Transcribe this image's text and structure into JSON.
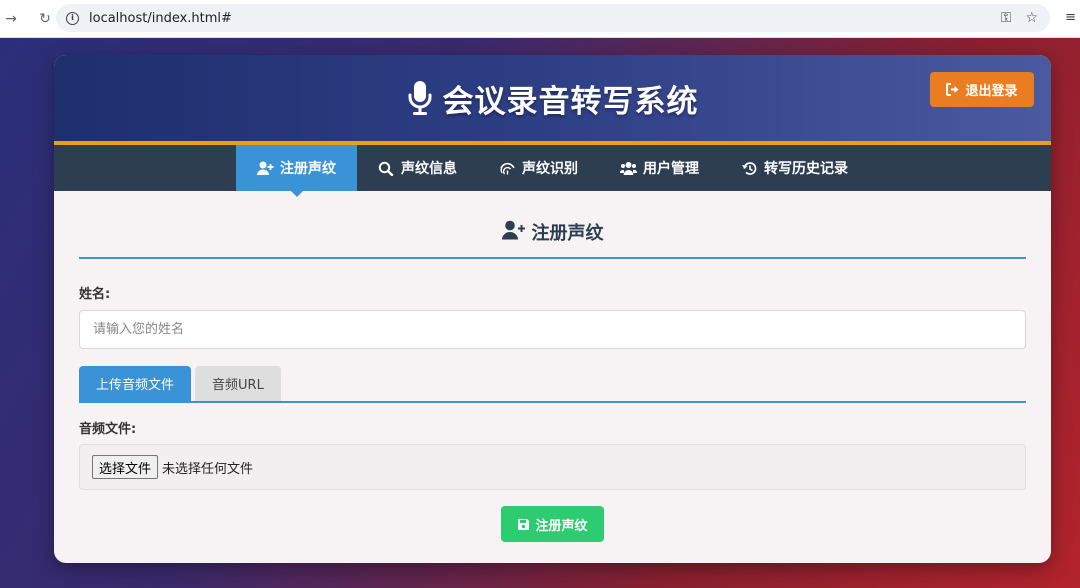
{
  "browser": {
    "url": "localhost/index.html#"
  },
  "header": {
    "title": "会议录音转写系统",
    "logout_label": "退出登录"
  },
  "nav": {
    "items": [
      {
        "label": "注册声纹",
        "icon": "user-plus-icon",
        "active": true
      },
      {
        "label": "声纹信息",
        "icon": "search-icon",
        "active": false
      },
      {
        "label": "声纹识别",
        "icon": "fingerprint-icon",
        "active": false
      },
      {
        "label": "用户管理",
        "icon": "users-icon",
        "active": false
      },
      {
        "label": "转写历史记录",
        "icon": "history-icon",
        "active": false
      }
    ]
  },
  "register": {
    "section_title": "注册声纹",
    "name_label": "姓名:",
    "name_placeholder": "请输入您的姓名",
    "tabs": [
      {
        "label": "上传音频文件",
        "active": true
      },
      {
        "label": "音频URL",
        "active": false
      }
    ],
    "file_label": "音频文件:",
    "choose_file_label": "选择文件",
    "no_file_text": "未选择任何文件",
    "submit_label": "注册声纹"
  },
  "colors": {
    "header_accent": "#f39c12",
    "nav_bg": "#2c3e50",
    "active_blue": "#3a93d6",
    "logout_orange": "#ea7d22",
    "submit_green": "#2ecc71"
  }
}
